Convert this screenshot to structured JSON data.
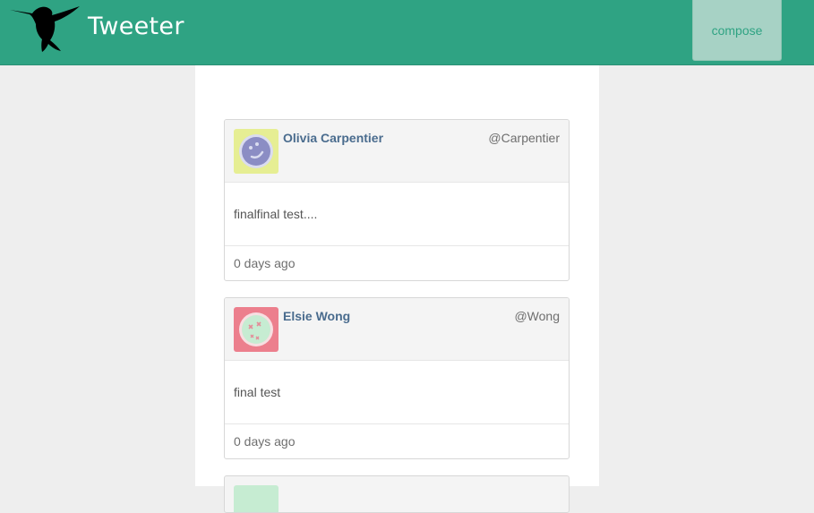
{
  "navbar": {
    "brand": "Tweeter",
    "compose_label": "compose",
    "logo_icon": "hummingbird-icon",
    "color": "#2fa383"
  },
  "tweets": [
    {
      "name": "Olivia Carpentier",
      "handle": "@Carpentier",
      "text": "finalfinal test....",
      "time": "0 days ago",
      "avatar_icon": "face-avatar-icon",
      "avatar_bg": "#e6ee93",
      "avatar_face": "#8b8dc4"
    },
    {
      "name": "Elsie Wong",
      "handle": "@Wong",
      "text": "final test",
      "time": "0 days ago",
      "avatar_icon": "face-avatar-icon",
      "avatar_bg": "#ec7f8d",
      "avatar_face": "#c6ecd2"
    }
  ]
}
